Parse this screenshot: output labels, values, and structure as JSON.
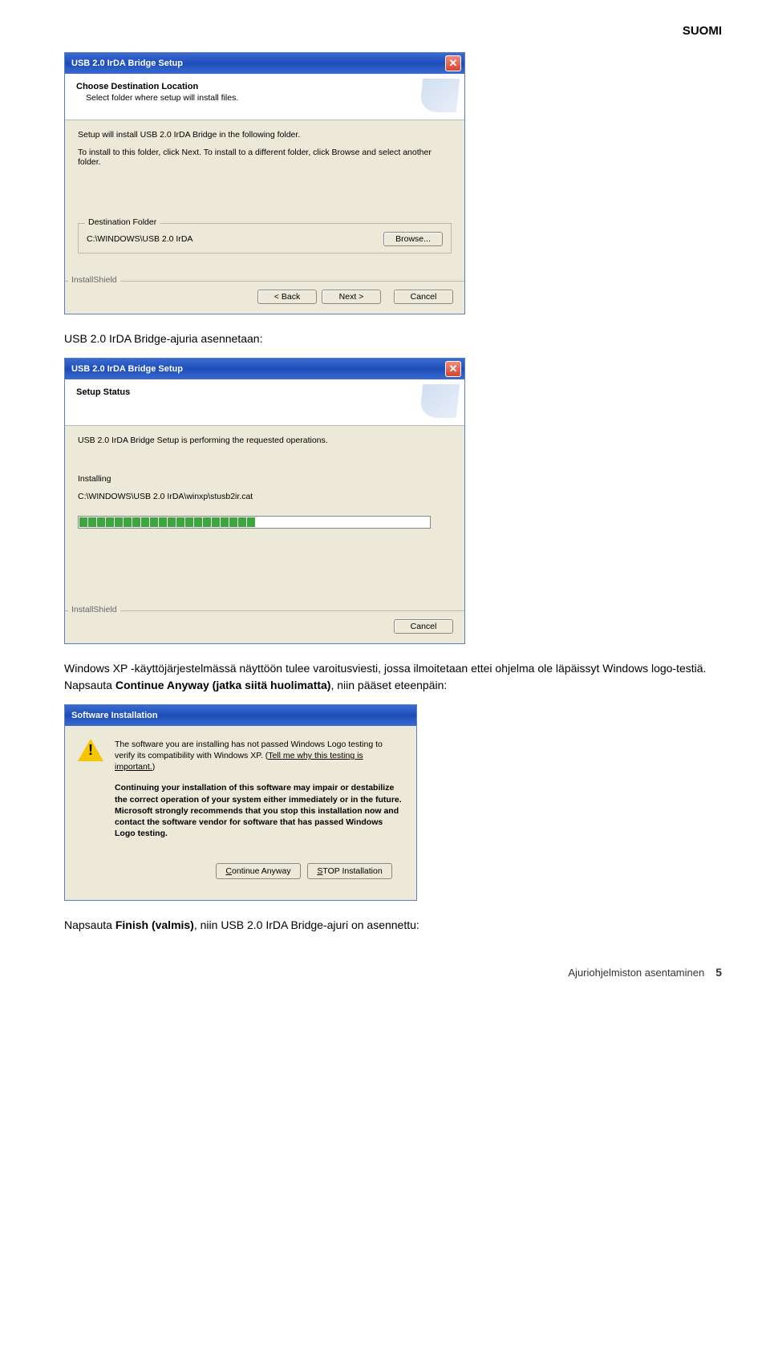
{
  "header": {
    "lang": "SUOMI"
  },
  "dialog1": {
    "title": "USB 2.0 IrDA Bridge Setup",
    "banner_title": "Choose Destination Location",
    "banner_sub": "Select folder where setup will install files.",
    "line1": "Setup will install USB 2.0 IrDA Bridge in the following folder.",
    "line2": "To install to this folder, click Next. To install to a different folder, click Browse and select another folder.",
    "dest_label": "Destination Folder",
    "dest_path": "C:\\WINDOWS\\USB 2.0 IrDA",
    "browse": "Browse...",
    "back": "< Back",
    "next": "Next >",
    "cancel": "Cancel",
    "brand": "InstallShield"
  },
  "caption1": "USB 2.0 IrDA Bridge-ajuria asennetaan:",
  "dialog2": {
    "title": "USB 2.0 IrDA Bridge Setup",
    "banner_title": "Setup Status",
    "line1": "USB 2.0 IrDA Bridge Setup is performing the requested operations.",
    "installing": "Installing",
    "path": "C:\\WINDOWS\\USB 2.0 IrDA\\winxp\\stusb2ir.cat",
    "cancel": "Cancel",
    "brand": "InstallShield"
  },
  "caption2_a": "Windows XP -käyttöjärjestelmässä näyttöön tulee varoitusviesti, jossa ilmoitetaan ettei ohjelma ole läpäissyt Windows logo-testiä. Napsauta ",
  "caption2_b": "Continue Anyway (jatka siitä huolimatta)",
  "caption2_c": ", niin pääset eteenpäin:",
  "dialog3": {
    "title": "Software Installation",
    "p1": "The software you are installing has not passed Windows Logo testing to verify its compatibility with Windows XP. (",
    "link": "Tell me why this testing is important.",
    "p1b": ")",
    "p2": "Continuing your installation of this software may impair or destabilize the correct operation of your system either immediately or in the future. Microsoft strongly recommends that you stop this installation now and contact the software vendor for software that has passed Windows Logo testing.",
    "btn_continue": "Continue Anyway",
    "btn_stop": "STOP Installation"
  },
  "caption3_a": "Napsauta ",
  "caption3_b": "Finish (valmis)",
  "caption3_c": ", niin USB 2.0 IrDA Bridge-ajuri on asennettu:",
  "footer": {
    "label": "Ajuriohjelmiston asentaminen",
    "page": "5"
  }
}
